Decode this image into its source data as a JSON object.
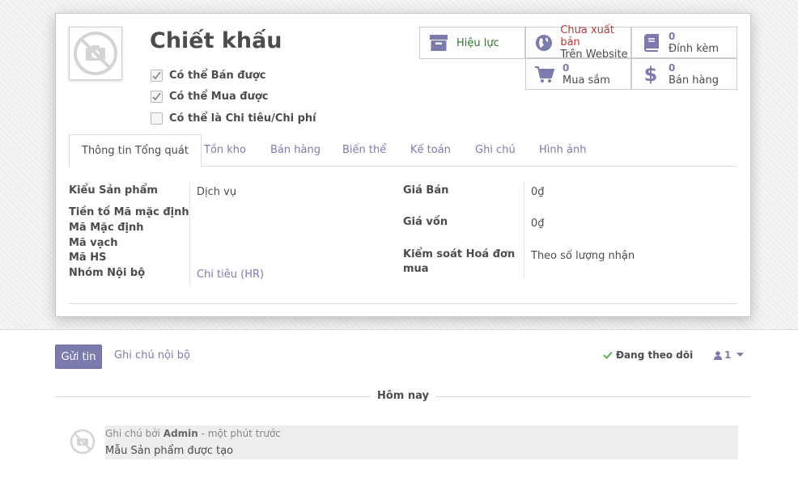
{
  "product": {
    "name": "Chiết khấu",
    "checkboxes": [
      {
        "label": "Có thể Bán được",
        "checked": true
      },
      {
        "label": "Có thể Mua được",
        "checked": true
      },
      {
        "label": "Có thể là Chi tiêu/Chi phí",
        "checked": false
      }
    ]
  },
  "smart_buttons": {
    "active": {
      "label": "Hiệu lực",
      "icon": "archive-icon",
      "color": "#2b7a2b"
    },
    "website": {
      "line1": "Chưa xuất bản",
      "line2": "Trên Website",
      "icon": "globe-icon",
      "color": "#b23b3b"
    },
    "attachments": {
      "count": "0",
      "label": "Đính kèm",
      "icon": "book-icon"
    },
    "purchases": {
      "count": "0",
      "label": "Mua sắm",
      "icon": "cart-icon"
    },
    "sales": {
      "count": "0",
      "label": "Bán hàng",
      "icon": "dollar-icon"
    }
  },
  "tabs": [
    "Thông tin Tổng quát",
    "Tồn kho",
    "Bán hàng",
    "Biến thể",
    "Kế toán",
    "Ghi chú",
    "Hình ảnh"
  ],
  "fields": {
    "product_type": {
      "label": "Kiểu Sản phẩm",
      "value": "Dịch vụ"
    },
    "default_code_prefix": {
      "label": "Tiền tố Mã mặc định"
    },
    "internal_ref": {
      "label": "Mã Mặc định"
    },
    "barcode": {
      "label": "Mã vạch"
    },
    "hs_code": {
      "label": "Mã HS"
    },
    "internal_category": {
      "label": "Nhóm Nội bộ",
      "value": "Chi tiêu (HR)"
    },
    "sale_price": {
      "label": "Giá Bán",
      "value": "0₫"
    },
    "cost": {
      "label": "Giá vốn",
      "value": "0₫"
    },
    "bill_control": {
      "label": "Kiểm soát Hoá đơn mua",
      "value": "Theo số lượng nhận"
    }
  },
  "chatter": {
    "send_message": "Gửi tin",
    "log_note": "Ghi chú nội bộ",
    "following": "Đang theo dõi",
    "followers_count": "1",
    "date_separator": "Hôm nay",
    "message": {
      "prefix": "Ghi chú bởi",
      "author": "Admin",
      "time": "- một phút trước",
      "body": "Mẫu Sản phẩm được tạo"
    }
  },
  "colors": {
    "primary": "#7c7bad",
    "success": "#2b7a2b",
    "danger": "#b23b3b",
    "check": "#5cb85c"
  }
}
